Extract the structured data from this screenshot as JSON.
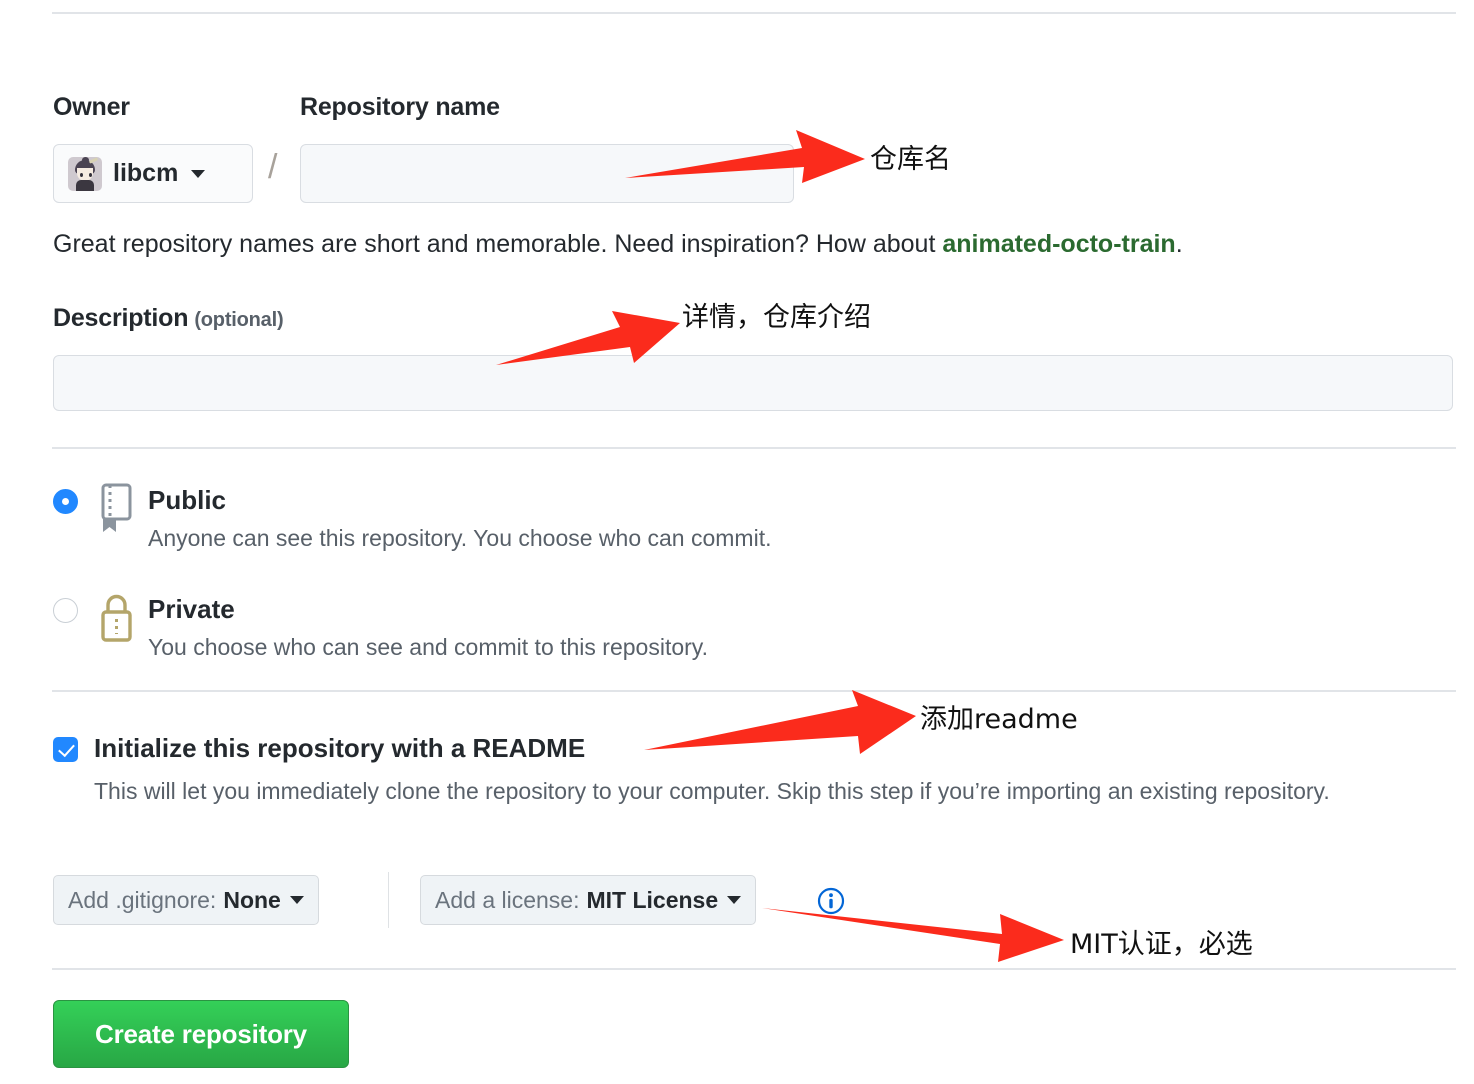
{
  "form": {
    "owner": {
      "label": "Owner",
      "name": "libcm",
      "avatar_icon": "user-avatar"
    },
    "separator": "/",
    "repository_name": {
      "label": "Repository name",
      "value": "",
      "placeholder": ""
    },
    "repo_name_hint": {
      "text_before": "Great repository names are short and memorable. Need inspiration? How about ",
      "suggestion": "animated-octo-train",
      "text_after": ".",
      "suggestion_color": "#2b6a30"
    },
    "description": {
      "label": "Description",
      "optional_note": "(optional)",
      "value": "",
      "placeholder": ""
    },
    "visibility": {
      "options": [
        {
          "id": "public",
          "title": "Public",
          "description": "Anyone can see this repository. You choose who can commit.",
          "icon": "repo-book-icon",
          "icon_color": "#8b949e",
          "selected": true
        },
        {
          "id": "private",
          "title": "Private",
          "description": "You choose who can see and commit to this repository.",
          "icon": "lock-icon",
          "icon_color": "#b4a56a",
          "selected": false
        }
      ],
      "selected_color": "#2188ff"
    },
    "initialize": {
      "checked": true,
      "title": "Initialize this repository with a README",
      "description": "This will let you immediately clone the repository to your computer. Skip this step if you’re importing an existing repository."
    },
    "gitignore": {
      "prefix": "Add .gitignore:",
      "value": "None",
      "caret_icon": "chevron-down-icon"
    },
    "license": {
      "prefix": "Add a license:",
      "value": "MIT License",
      "caret_icon": "chevron-down-icon",
      "info_icon": "info-circle-icon",
      "info_icon_color": "#0366d6"
    },
    "submit": {
      "label": "Create repository",
      "color": "#28a745"
    }
  },
  "annotations": {
    "arrow_color": "#fb2b1c",
    "items": [
      {
        "id": "repo-name",
        "text": "仓库名"
      },
      {
        "id": "description",
        "text": "详情，仓库介绍"
      },
      {
        "id": "readme",
        "text": "添加readme"
      },
      {
        "id": "license",
        "text": "MIT认证，必选"
      }
    ]
  }
}
